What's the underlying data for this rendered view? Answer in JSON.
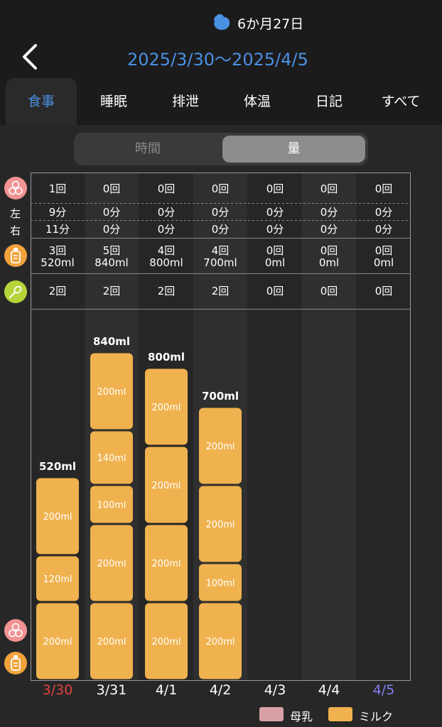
{
  "header": {
    "age": "6か月27日",
    "range": "2025/3/30〜2025/4/5"
  },
  "tabs": [
    "食事",
    "睡眠",
    "排泄",
    "体温",
    "日記",
    "すべて"
  ],
  "segment": {
    "left": "時間",
    "right": "量",
    "selected": "量"
  },
  "side_labels": {
    "left": "左",
    "right": "右"
  },
  "summary": {
    "breast_count": [
      "1回",
      "0回",
      "0回",
      "0回",
      "0回",
      "0回",
      "0回"
    ],
    "left_min": [
      "9分",
      "0分",
      "0分",
      "0分",
      "0分",
      "0分",
      "0分"
    ],
    "right_min": [
      "11分",
      "0分",
      "0分",
      "0分",
      "0分",
      "0分",
      "0分"
    ],
    "milk_count": [
      "3回",
      "5回",
      "4回",
      "4回",
      "0回",
      "0回",
      "0回"
    ],
    "milk_ml": [
      "520ml",
      "840ml",
      "800ml",
      "700ml",
      "0ml",
      "0ml",
      "0ml"
    ],
    "food_count": [
      "2回",
      "2回",
      "2回",
      "2回",
      "0回",
      "0回",
      "0回"
    ]
  },
  "chart_data": {
    "type": "bar",
    "stacked": true,
    "categories": [
      "3/30",
      "3/31",
      "4/1",
      "4/2",
      "4/3",
      "4/4",
      "4/5"
    ],
    "category_colors": [
      "#e0443c",
      "#ffffff",
      "#ffffff",
      "#ffffff",
      "#ffffff",
      "#ffffff",
      "#8080f0"
    ],
    "totals": [
      "520ml",
      "840ml",
      "800ml",
      "700ml",
      "",
      "",
      ""
    ],
    "segments": [
      [
        200,
        120,
        200
      ],
      [
        200,
        200,
        100,
        140,
        200
      ],
      [
        200,
        200,
        200,
        200
      ],
      [
        200,
        100,
        200,
        200
      ],
      [],
      [],
      []
    ],
    "segment_label_unit": "ml",
    "series": [
      {
        "name": "母乳",
        "color": "#d8a0a6"
      },
      {
        "name": "ミルク",
        "color": "#f0b24e"
      }
    ],
    "ylim": [
      0,
      920
    ],
    "legend_position": "bottom-right"
  },
  "colors": {
    "accent": "#4a90e2",
    "milk": "#f0b24e",
    "breast": "#d8a0a6",
    "food": "#b5d43a",
    "breast_icon": "#f29393",
    "bottle_icon": "#f2a33c"
  }
}
